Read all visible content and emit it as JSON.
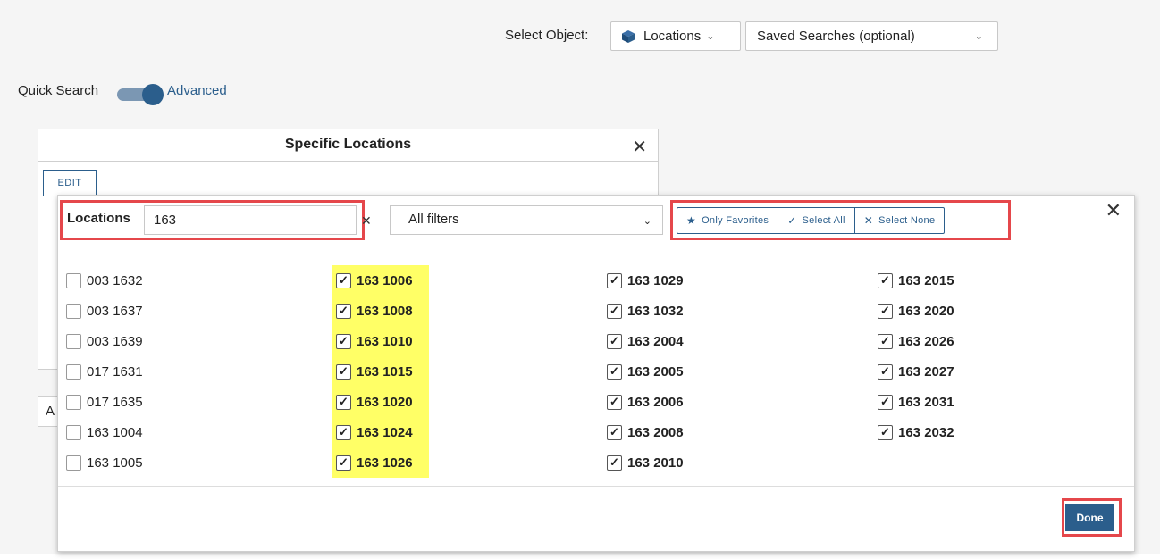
{
  "header": {
    "select_object_label": "Select Object:",
    "object_value": "Locations",
    "saved_searches_value": "Saved Searches (optional)"
  },
  "search_mode": {
    "quick_label": "Quick Search",
    "advanced_label": "Advanced"
  },
  "specific_panel": {
    "title": "Specific Locations",
    "edit_label": "EDIT",
    "fragment_text": "A"
  },
  "modal": {
    "locations_label": "Locations",
    "locations_value": "163",
    "filters_value": "All filters",
    "only_favorites_label": "Only Favorites",
    "select_all_label": "Select All",
    "select_none_label": "Select None",
    "done_label": "Done",
    "columns": [
      [
        {
          "label": "003 1632",
          "checked": false
        },
        {
          "label": "003 1637",
          "checked": false
        },
        {
          "label": "003 1639",
          "checked": false
        },
        {
          "label": "017 1631",
          "checked": false
        },
        {
          "label": "017 1635",
          "checked": false
        },
        {
          "label": "163 1004",
          "checked": false
        },
        {
          "label": "163 1005",
          "checked": false
        }
      ],
      [
        {
          "label": "163 1006",
          "checked": true
        },
        {
          "label": "163 1008",
          "checked": true
        },
        {
          "label": "163 1010",
          "checked": true
        },
        {
          "label": "163 1015",
          "checked": true
        },
        {
          "label": "163 1020",
          "checked": true
        },
        {
          "label": "163 1024",
          "checked": true
        },
        {
          "label": "163 1026",
          "checked": true
        }
      ],
      [
        {
          "label": "163 1029",
          "checked": true
        },
        {
          "label": "163 1032",
          "checked": true
        },
        {
          "label": "163 2004",
          "checked": true
        },
        {
          "label": "163 2005",
          "checked": true
        },
        {
          "label": "163 2006",
          "checked": true
        },
        {
          "label": "163 2008",
          "checked": true
        },
        {
          "label": "163 2010",
          "checked": true
        }
      ],
      [
        {
          "label": "163 2015",
          "checked": true
        },
        {
          "label": "163 2020",
          "checked": true
        },
        {
          "label": "163 2026",
          "checked": true
        },
        {
          "label": "163 2027",
          "checked": true
        },
        {
          "label": "163 2031",
          "checked": true
        },
        {
          "label": "163 2032",
          "checked": true
        }
      ]
    ]
  },
  "colors": {
    "accent": "#2b5e8c",
    "highlight": "#ffff66",
    "callout": "#e5474b"
  }
}
